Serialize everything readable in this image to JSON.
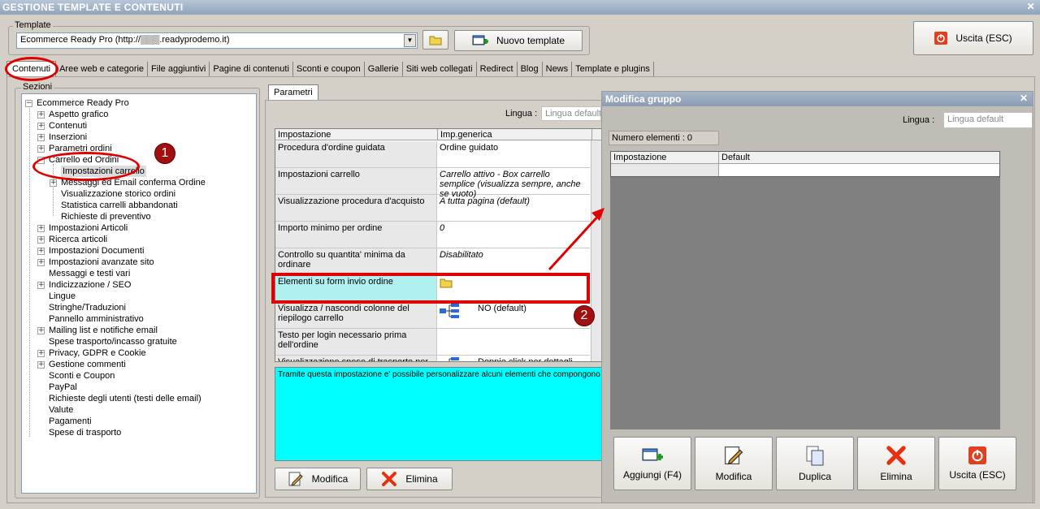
{
  "window": {
    "title": "GESTIONE TEMPLATE E CONTENUTI",
    "close": "✕"
  },
  "template": {
    "group_label": "Template",
    "value": "Ecommerce Ready Pro (http://▒▒▒.readyprodemo.it)",
    "new_template": "Nuovo template",
    "exit": "Uscita (ESC)"
  },
  "tabs": [
    "Contenuti",
    "Aree web e categorie",
    "File aggiuntivi",
    "Pagine di contenuti",
    "Sconti e coupon",
    "Gallerie",
    "Siti web collegati",
    "Redirect",
    "Blog",
    "News",
    "Template e plugins"
  ],
  "sections": {
    "label": "Sezioni",
    "root": "Ecommerce Ready Pro",
    "items_a": [
      {
        "label": "Aspetto grafico",
        "exp": "+"
      },
      {
        "label": "Contenuti",
        "exp": "+"
      },
      {
        "label": "Inserzioni",
        "exp": "+"
      },
      {
        "label": "Parametri ordini",
        "exp": "+"
      },
      {
        "label": "Carrello ed Ordini",
        "exp": "−"
      }
    ],
    "children": [
      {
        "label": "Impostazioni carrello",
        "exp": ""
      },
      {
        "label": "Messaggi ed Email conferma Ordine",
        "exp": "+"
      },
      {
        "label": "Visualizzazione storico ordini",
        "exp": ""
      },
      {
        "label": "Statistica carrelli abbandonati",
        "exp": ""
      },
      {
        "label": "Richieste di preventivo",
        "exp": ""
      }
    ],
    "items_b": [
      {
        "label": "Impostazioni Articoli",
        "exp": "+"
      },
      {
        "label": "Ricerca articoli",
        "exp": "+"
      },
      {
        "label": "Impostazioni Documenti",
        "exp": "+"
      },
      {
        "label": "Impostazioni avanzate sito",
        "exp": "+"
      },
      {
        "label": "Messaggi e testi vari",
        "exp": ""
      },
      {
        "label": "Indicizzazione / SEO",
        "exp": "+"
      },
      {
        "label": "Lingue",
        "exp": ""
      },
      {
        "label": "Stringhe/Traduzioni",
        "exp": ""
      },
      {
        "label": "Pannello amministrativo",
        "exp": ""
      },
      {
        "label": "Mailing list e notifiche email",
        "exp": "+"
      },
      {
        "label": "Spese trasporto/incasso gratuite",
        "exp": ""
      },
      {
        "label": "Privacy, GDPR e Cookie",
        "exp": "+"
      },
      {
        "label": "Gestione commenti",
        "exp": "+"
      },
      {
        "label": "Sconti e Coupon",
        "exp": ""
      },
      {
        "label": "PayPal",
        "exp": ""
      },
      {
        "label": "Richieste degli utenti (testi delle email)",
        "exp": ""
      },
      {
        "label": "Valute",
        "exp": ""
      },
      {
        "label": "Pagamenti",
        "exp": ""
      },
      {
        "label": "Spese di trasporto",
        "exp": ""
      }
    ]
  },
  "params": {
    "tab": "Parametri",
    "lingua_label": "Lingua :",
    "lingua_placeholder": "Lingua default",
    "headers": [
      "Impostazione",
      "Imp.generica"
    ],
    "rows": [
      {
        "k": "Procedura d'ordine guidata",
        "v": "Ordine guidato"
      },
      {
        "k": "Impostazioni carrello",
        "v": "Carrello attivo - Box carrello semplice (visualizza sempre, anche se vuoto)"
      },
      {
        "k": "Visualizzazione procedura d'acquisto",
        "v": "A tutta pagina (default)"
      },
      {
        "k": "Importo minimo per ordine",
        "v": "0"
      },
      {
        "k": "Controllo su quantita' minima da ordinare",
        "v": "Disabilitato"
      },
      {
        "k": "Elementi su form invio ordine",
        "v": ""
      },
      {
        "k": "Visualizza / nascondi colonne del riepilogo carrello",
        "v": "NO (default)"
      },
      {
        "k": "Testo per login necessario prima dell'ordine",
        "v": ""
      },
      {
        "k": "Visualizzazione spese di trasporto per",
        "v": "Doppio click per dettagli"
      }
    ],
    "description": "Tramite questa impostazione e' possibile personalizzare alcuni elementi che compongono il",
    "modifica": "Modifica",
    "elimina": "Elimina"
  },
  "modal": {
    "title": "Modifica gruppo",
    "close": "✕",
    "lingua_label": "Lingua :",
    "lingua_placeholder": "Lingua default",
    "count": "Numero elementi : 0",
    "headers": [
      "Impostazione",
      "Default"
    ],
    "buttons": {
      "add": "Aggiungi (F4)",
      "edit": "Modifica",
      "dup": "Duplica",
      "del": "Elimina",
      "exit": "Uscita (ESC)"
    }
  },
  "annotations": {
    "badge1": "1",
    "badge2": "2"
  }
}
